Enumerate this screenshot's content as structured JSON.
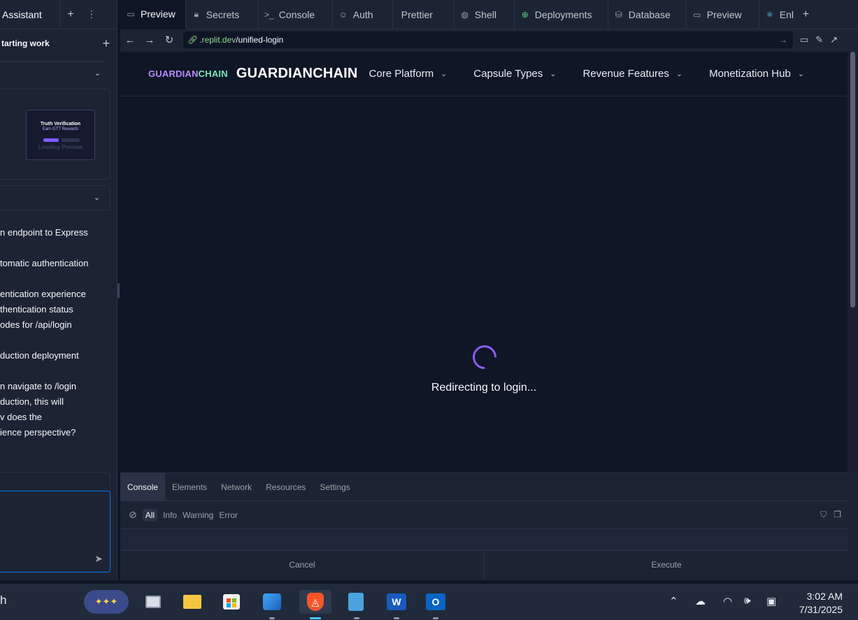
{
  "left_panel": {
    "tab_label": "Assistant",
    "plus": "+",
    "dots": "⋮",
    "header": "tarting work",
    "header_plus": "+",
    "thumbnail": {
      "title": "Truth Verification",
      "subtitle": "Earn GTT Rewards",
      "faded": "Loading Preview"
    },
    "messages": [
      "n endpoint to Express",
      "",
      "tomatic authentication",
      "",
      "entication experience",
      "thentication status",
      "odes for /api/login",
      "",
      "duction deployment",
      "",
      "n navigate to /login",
      "duction, this will",
      "v does the",
      "ience perspective?"
    ],
    "send_icon": "➤"
  },
  "tabs": [
    {
      "label": "Preview",
      "icon": "▭",
      "active": true
    },
    {
      "label": "Secrets",
      "icon": "🔒"
    },
    {
      "label": "Console",
      "icon": ">_"
    },
    {
      "label": "Auth",
      "icon": "👤"
    },
    {
      "label": "Prettier",
      "icon": ""
    },
    {
      "label": "Shell",
      "icon": "◍"
    },
    {
      "label": "Deployments",
      "icon": "⊕"
    },
    {
      "label": "Database",
      "icon": "⛁"
    },
    {
      "label": "Preview",
      "icon": "▭"
    },
    {
      "label": "Enl",
      "icon": "⚛"
    }
  ],
  "tab_add": "+",
  "url": {
    "host": ".replit.dev",
    "path": "/unified-login"
  },
  "app": {
    "logo_part1": "GUARDIAN",
    "logo_part2": "CHAIN",
    "logo_big": "GUARDIANCHAIN",
    "menu": [
      "Core Platform",
      "Capsule Types",
      "Revenue Features",
      "Monetization Hub"
    ],
    "status": "Redirecting to login..."
  },
  "devtools": {
    "tabs": [
      "Console",
      "Elements",
      "Network",
      "Resources",
      "Settings"
    ],
    "filters": [
      "All",
      "Info",
      "Warning",
      "Error"
    ],
    "cancel": "Cancel",
    "execute": "Execute"
  },
  "taskbar": {
    "search_fragment": "h",
    "time": "3:02 AM",
    "date": "7/31/2025"
  },
  "colors": {
    "accent_purple": "#8b5cf6",
    "logo_purple": "#b78bff",
    "logo_green": "#7be8b6",
    "url_green": "#8fd88f"
  }
}
